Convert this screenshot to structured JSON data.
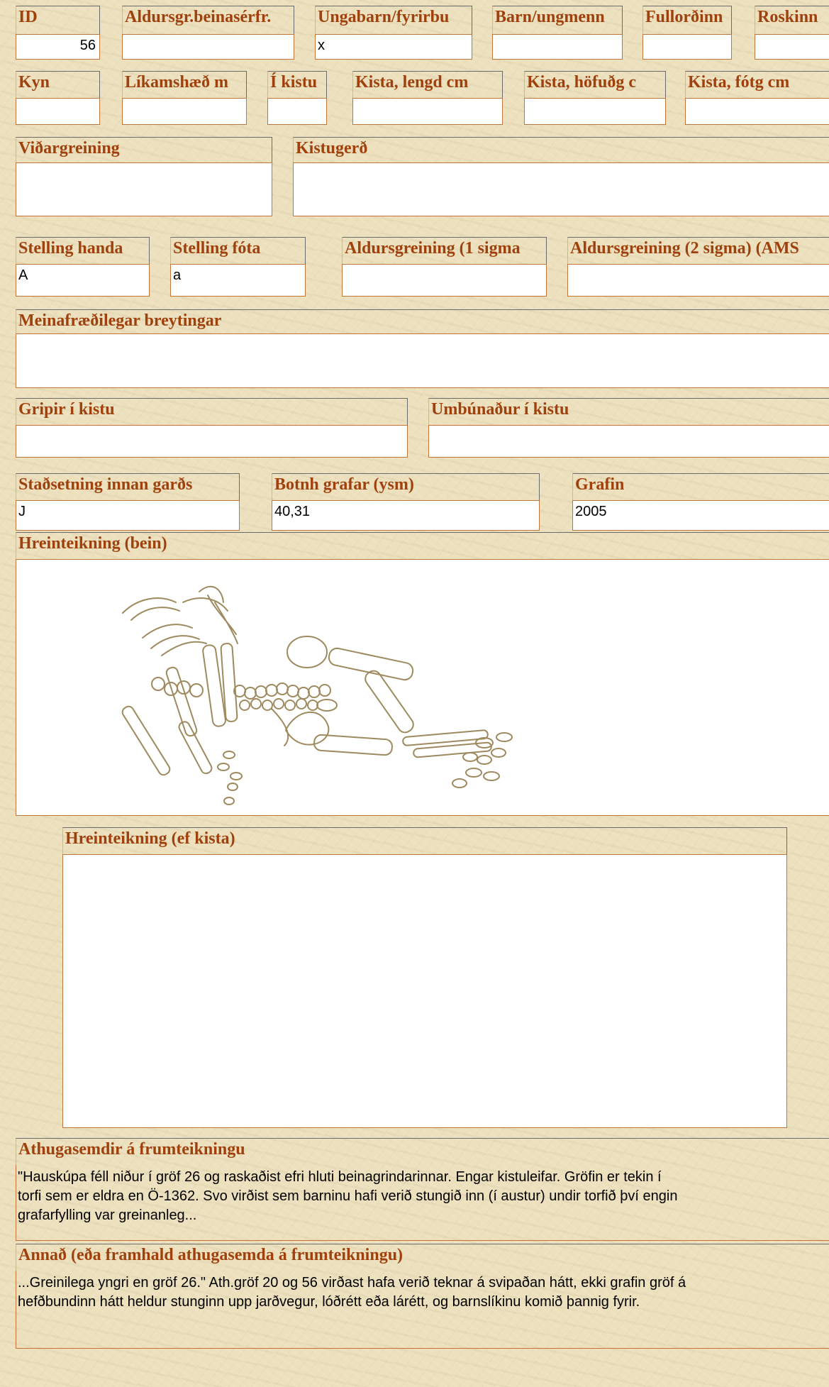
{
  "fields": {
    "id": {
      "label": "ID",
      "value": "56"
    },
    "aldursgr_beinasfr": {
      "label": "Aldursgr.beinasérfr.",
      "value": ""
    },
    "ungabarn": {
      "label": "Ungabarn/fyrirbu",
      "value": "x"
    },
    "barn_ungmenn": {
      "label": "Barn/ungmenn",
      "value": ""
    },
    "fullordinn": {
      "label": "Fullorðinn",
      "value": ""
    },
    "roskinn": {
      "label": "Roskinn",
      "value": ""
    },
    "kyn": {
      "label": "Kyn",
      "value": ""
    },
    "likamshaed": {
      "label": "Líkamshæð m",
      "value": ""
    },
    "i_kistu": {
      "label": "Í kistu",
      "value": ""
    },
    "kista_lengd": {
      "label": "Kista, lengd cm",
      "value": ""
    },
    "kista_hofud": {
      "label": "Kista, höfuðg c",
      "value": ""
    },
    "kista_fotg": {
      "label": "Kista, fótg cm",
      "value": ""
    },
    "vidargreining": {
      "label": "Viðargreining",
      "value": ""
    },
    "kistugerd": {
      "label": "Kistugerð",
      "value": ""
    },
    "stelling_handa": {
      "label": "Stelling handa",
      "value": "A"
    },
    "stelling_fota": {
      "label": "Stelling fóta",
      "value": "a"
    },
    "aldursgreining_1": {
      "label": "Aldursgreining (1 sigma",
      "value": ""
    },
    "aldursgreining_2": {
      "label": "Aldursgreining (2 sigma) (AMS",
      "value": ""
    },
    "meinafraedilegar": {
      "label": "Meinafræðilegar breytingar",
      "value": ""
    },
    "gripir": {
      "label": "Gripir í kistu",
      "value": ""
    },
    "umbunadur": {
      "label": "Umbúnaður í kistu",
      "value": ""
    },
    "stadsetning": {
      "label": "Staðsetning innan garðs",
      "value": "J"
    },
    "botnh": {
      "label": "Botnh grafar (ysm)",
      "value": "40,31"
    },
    "grafin": {
      "label": "Grafin",
      "value": "2005"
    },
    "hreinteikning_bein": {
      "label": "Hreinteikning (bein)"
    },
    "hreinteikning_kista": {
      "label": "Hreinteikning (ef kista)"
    },
    "athugasemdir": {
      "label": "Athugasemdir á frumteikningu",
      "lines": [
        "\"Hauskúpa féll niður í gröf 26 og raskaðist efri hluti beinagrindarinnar. Engar kistuleifar. Gröfin er tekin í",
        "torfi sem er eldra en Ö-1362. Svo virðist sem barninu hafi verið stungið inn (í austur) undir torfið því engin",
        "grafarfylling var greinanleg..."
      ]
    },
    "annad": {
      "label": "Annað (eða framhald athugasemda á frumteikningu)",
      "lines": [
        "...Greinilega yngri en gröf 26.\"  Ath.gröf 20 og 56 virðast hafa verið teknar á svipaðan hátt, ekki grafin gröf á",
        "hefðbundinn hátt heldur stunginn upp jarðvegur, lóðrétt eða lárétt, og barnslíkinu komið þannig fyrir."
      ]
    }
  }
}
